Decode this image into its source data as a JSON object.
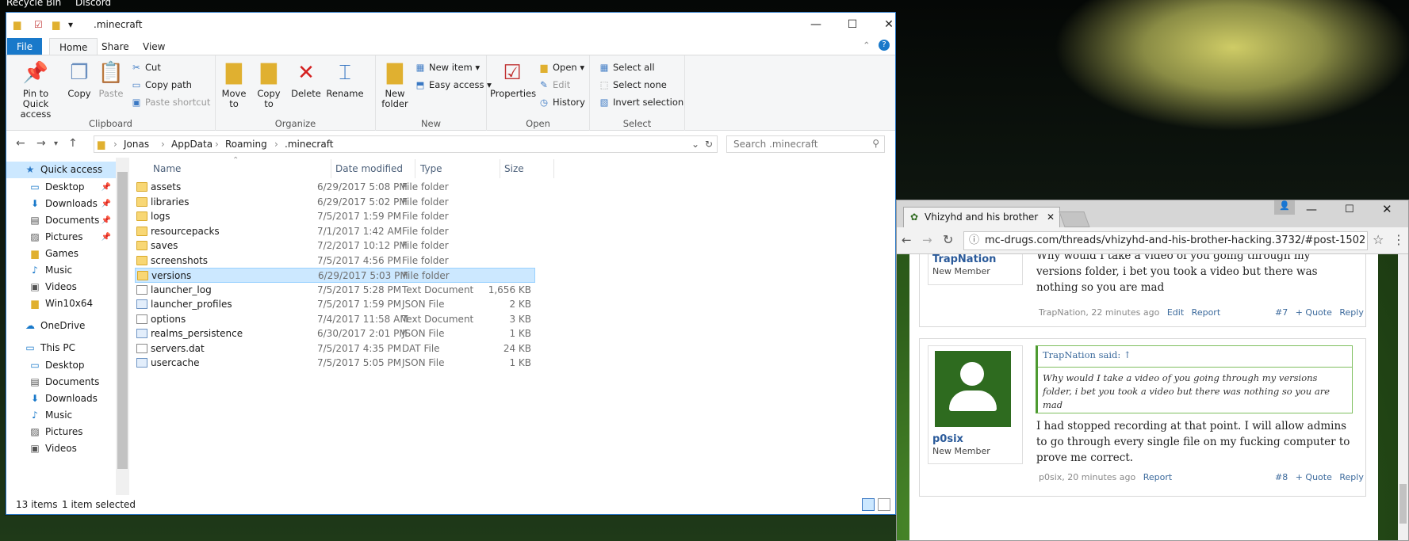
{
  "desktop": {
    "icons": [
      "Recycle Bin",
      "Discord"
    ]
  },
  "explorer": {
    "title": ".minecraft",
    "tabs": [
      "File",
      "Home",
      "Share",
      "View"
    ],
    "ribbon": {
      "clipboard": {
        "label": "Clipboard",
        "pin": "Pin to Quick access",
        "copy": "Copy",
        "paste": "Paste",
        "cut": "Cut",
        "copy_path": "Copy path",
        "paste_shortcut": "Paste shortcut"
      },
      "organize": {
        "label": "Organize",
        "move_to": "Move to",
        "copy_to": "Copy to",
        "delete": "Delete",
        "rename": "Rename"
      },
      "new": {
        "label": "New",
        "new_folder": "New folder",
        "new_item": "New item",
        "easy_access": "Easy access"
      },
      "open": {
        "label": "Open",
        "properties": "Properties",
        "open": "Open",
        "edit": "Edit",
        "history": "History"
      },
      "select": {
        "label": "Select",
        "select_all": "Select all",
        "select_none": "Select none",
        "invert": "Invert selection"
      }
    },
    "address": {
      "crumbs": [
        "Jonas",
        "AppData",
        "Roaming",
        ".minecraft"
      ],
      "search_placeholder": "Search .minecraft"
    },
    "nav": [
      {
        "label": "Quick access",
        "icon": "star-icon",
        "pin": false
      },
      {
        "label": "Desktop",
        "icon": "desktop-icon",
        "pin": true
      },
      {
        "label": "Downloads",
        "icon": "download-icon",
        "pin": true
      },
      {
        "label": "Documents",
        "icon": "documents-icon",
        "pin": true
      },
      {
        "label": "Pictures",
        "icon": "pictures-icon",
        "pin": true
      },
      {
        "label": "Games",
        "icon": "folder-icon",
        "pin": false
      },
      {
        "label": "Music",
        "icon": "music-icon",
        "pin": false
      },
      {
        "label": "Videos",
        "icon": "videos-icon",
        "pin": false
      },
      {
        "label": "Win10x64",
        "icon": "folder-icon",
        "pin": false
      },
      {
        "label": "OneDrive",
        "icon": "cloud-icon",
        "pin": false
      },
      {
        "label": "This PC",
        "icon": "computer-icon",
        "pin": false
      },
      {
        "label": "Desktop",
        "icon": "desktop-icon",
        "pin": false
      },
      {
        "label": "Documents",
        "icon": "documents-icon",
        "pin": false
      },
      {
        "label": "Downloads",
        "icon": "download-icon",
        "pin": false
      },
      {
        "label": "Music",
        "icon": "music-icon",
        "pin": false
      },
      {
        "label": "Pictures",
        "icon": "pictures-icon",
        "pin": false
      },
      {
        "label": "Videos",
        "icon": "videos-icon",
        "pin": false
      }
    ],
    "columns": {
      "name": "Name",
      "date": "Date modified",
      "type": "Type",
      "size": "Size"
    },
    "files": [
      {
        "name": "assets",
        "date": "6/29/2017 5:08 PM",
        "type": "File folder",
        "size": "",
        "kind": "folder"
      },
      {
        "name": "libraries",
        "date": "6/29/2017 5:02 PM",
        "type": "File folder",
        "size": "",
        "kind": "folder"
      },
      {
        "name": "logs",
        "date": "7/5/2017 1:59 PM",
        "type": "File folder",
        "size": "",
        "kind": "folder"
      },
      {
        "name": "resourcepacks",
        "date": "7/1/2017 1:42 AM",
        "type": "File folder",
        "size": "",
        "kind": "folder"
      },
      {
        "name": "saves",
        "date": "7/2/2017 10:12 PM",
        "type": "File folder",
        "size": "",
        "kind": "folder"
      },
      {
        "name": "screenshots",
        "date": "7/5/2017 4:56 PM",
        "type": "File folder",
        "size": "",
        "kind": "folder"
      },
      {
        "name": "versions",
        "date": "6/29/2017 5:03 PM",
        "type": "File folder",
        "size": "",
        "kind": "folder",
        "selected": true
      },
      {
        "name": "launcher_log",
        "date": "7/5/2017 5:28 PM",
        "type": "Text Document",
        "size": "1,656 KB",
        "kind": "doc"
      },
      {
        "name": "launcher_profiles",
        "date": "7/5/2017 1:59 PM",
        "type": "JSON File",
        "size": "2 KB",
        "kind": "json"
      },
      {
        "name": "options",
        "date": "7/4/2017 11:58 AM",
        "type": "Text Document",
        "size": "3 KB",
        "kind": "doc"
      },
      {
        "name": "realms_persistence",
        "date": "6/30/2017 2:01 PM",
        "type": "JSON File",
        "size": "1 KB",
        "kind": "json"
      },
      {
        "name": "servers.dat",
        "date": "7/5/2017 4:35 PM",
        "type": "DAT File",
        "size": "24 KB",
        "kind": "doc"
      },
      {
        "name": "usercache",
        "date": "7/5/2017 5:05 PM",
        "type": "JSON File",
        "size": "1 KB",
        "kind": "json"
      }
    ],
    "status": {
      "count": "13 items",
      "selected": "1 item selected"
    }
  },
  "chrome": {
    "tab_title": "Vhizyhd and his brother",
    "url": "mc-drugs.com/threads/vhizyhd-and-his-brother-hacking.3732/#post-1502",
    "post7": {
      "user": "TrapNation",
      "title": "New Member",
      "text": "Why would I take a video of you going through my versions folder, i bet you took a video but there was nothing so you are mad",
      "meta": "TrapNation, 22 minutes ago",
      "edit": "Edit",
      "report": "Report",
      "num": "#7",
      "quote": "+ Quote",
      "reply": "Reply"
    },
    "post8": {
      "user": "p0six",
      "title": "New Member",
      "quote_head": "TrapNation said: ↑",
      "quote_text": "Why would I take a video of you going through my versions folder, i bet you took a video but there was nothing so you are mad",
      "text": "I had stopped recording at that point. I will allow admins to go through every single file on my fucking computer to prove me correct.",
      "meta": "p0six, 20 minutes ago",
      "report": "Report",
      "num": "#8",
      "quote": "+ Quote",
      "reply": "Reply"
    }
  }
}
